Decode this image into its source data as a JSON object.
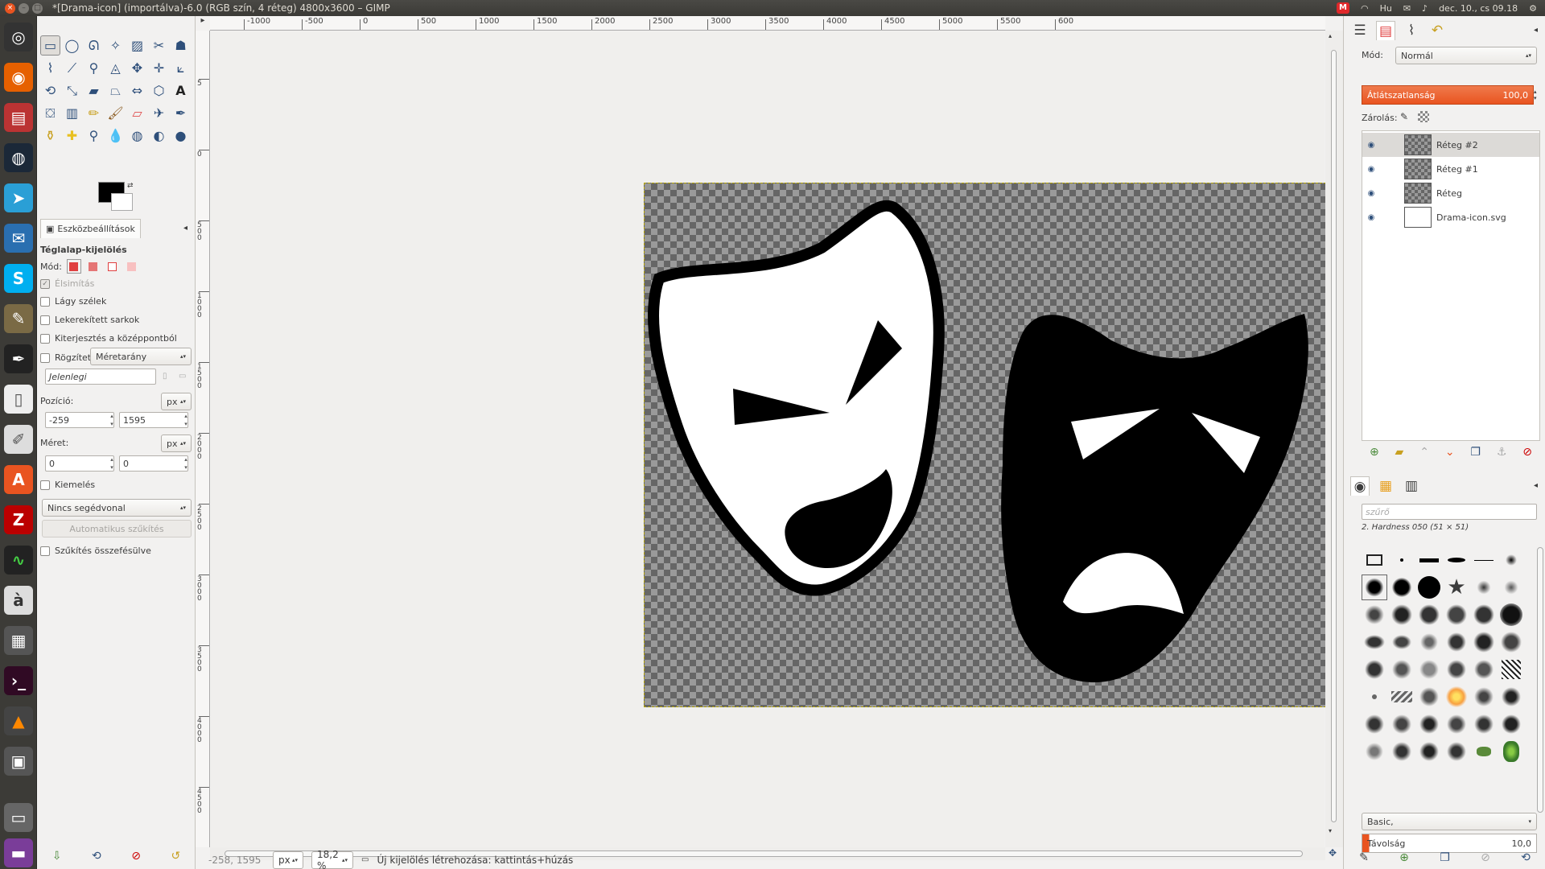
{
  "window": {
    "title": "*[Drama-icon] (importálva)-6.0 (RGB szín, 4 réteg) 4800x3600 – GIMP"
  },
  "indicators": {
    "mail_badge": "M",
    "kbd": "Hu",
    "clock": "dec. 10., cs 09.18"
  },
  "toolbox": {
    "tools": [
      "rect-select",
      "ellipse-select",
      "free-select",
      "fuzzy-select",
      "select-by-color",
      "scissors",
      "foreground-select",
      "paths",
      "color-picker",
      "zoom",
      "measure",
      "move",
      "align",
      "crop",
      "rotate",
      "scale",
      "shear",
      "perspective",
      "flip",
      "cage",
      "text",
      "bucket-fill",
      "blend",
      "pencil",
      "paintbrush",
      "eraser",
      "airbrush",
      "ink",
      "clone",
      "heal",
      "perspective-clone",
      "smudge",
      "convolve",
      "dodge-burn",
      "mypaint"
    ],
    "tab_title": "Eszközbeállítások",
    "tool_name": "Téglalap-kijelölés",
    "mode_label": "Mód:",
    "antialias_label": "Élsimítás",
    "feather_label": "Lágy szélek",
    "rounded_label": "Lekerekített sarkok",
    "expand_center_label": "Kiterjesztés a középpontból",
    "fixed_label": "Rögzített:",
    "fixed_value": "Méretarány",
    "current_value": "Jelenlegi",
    "position_label": "Pozíció:",
    "position_unit": "px",
    "pos_x": "-259",
    "pos_y": "1595",
    "size_label": "Méret:",
    "size_unit": "px",
    "size_w": "0",
    "size_h": "0",
    "highlight_label": "Kiemelés",
    "guides_value": "Nincs segédvonal",
    "auto_shrink_label": "Automatikus szűkítés",
    "shrink_merged_label": "Szűkítés összefésülve"
  },
  "canvas": {
    "ruler_labels": [
      "-1000",
      "-500",
      "0",
      "500",
      "1000",
      "1500",
      "2000",
      "2500",
      "3000",
      "3500",
      "4000",
      "4500",
      "5000",
      "5500",
      "600"
    ],
    "vruler_labels": [
      "5",
      "0",
      "500",
      "1000",
      "1500",
      "2000",
      "2500",
      "3000",
      "3500",
      "4000",
      "4500"
    ],
    "status_coords": "-258, 1595",
    "status_unit": "px",
    "status_zoom": "18,2 %",
    "status_message": "Új kijelölés létrehozása: kattintás+húzás"
  },
  "dock": {
    "mode_label": "Mód:",
    "mode_value": "Normál",
    "opacity_label": "Átlátszatlanság",
    "opacity_value": "100,0",
    "lock_label": "Zárolás:",
    "layers": [
      {
        "name": "Réteg #2",
        "active": true
      },
      {
        "name": "Réteg #1",
        "active": false
      },
      {
        "name": "Réteg",
        "active": false
      },
      {
        "name": "Drama-icon.svg",
        "active": false
      }
    ],
    "filter_placeholder": "szűrő",
    "brush_name": "2. Hardness 050 (51 × 51)",
    "brush_preset": "Basic,",
    "spacing_label": "Távolság",
    "spacing_value": "10,0"
  }
}
